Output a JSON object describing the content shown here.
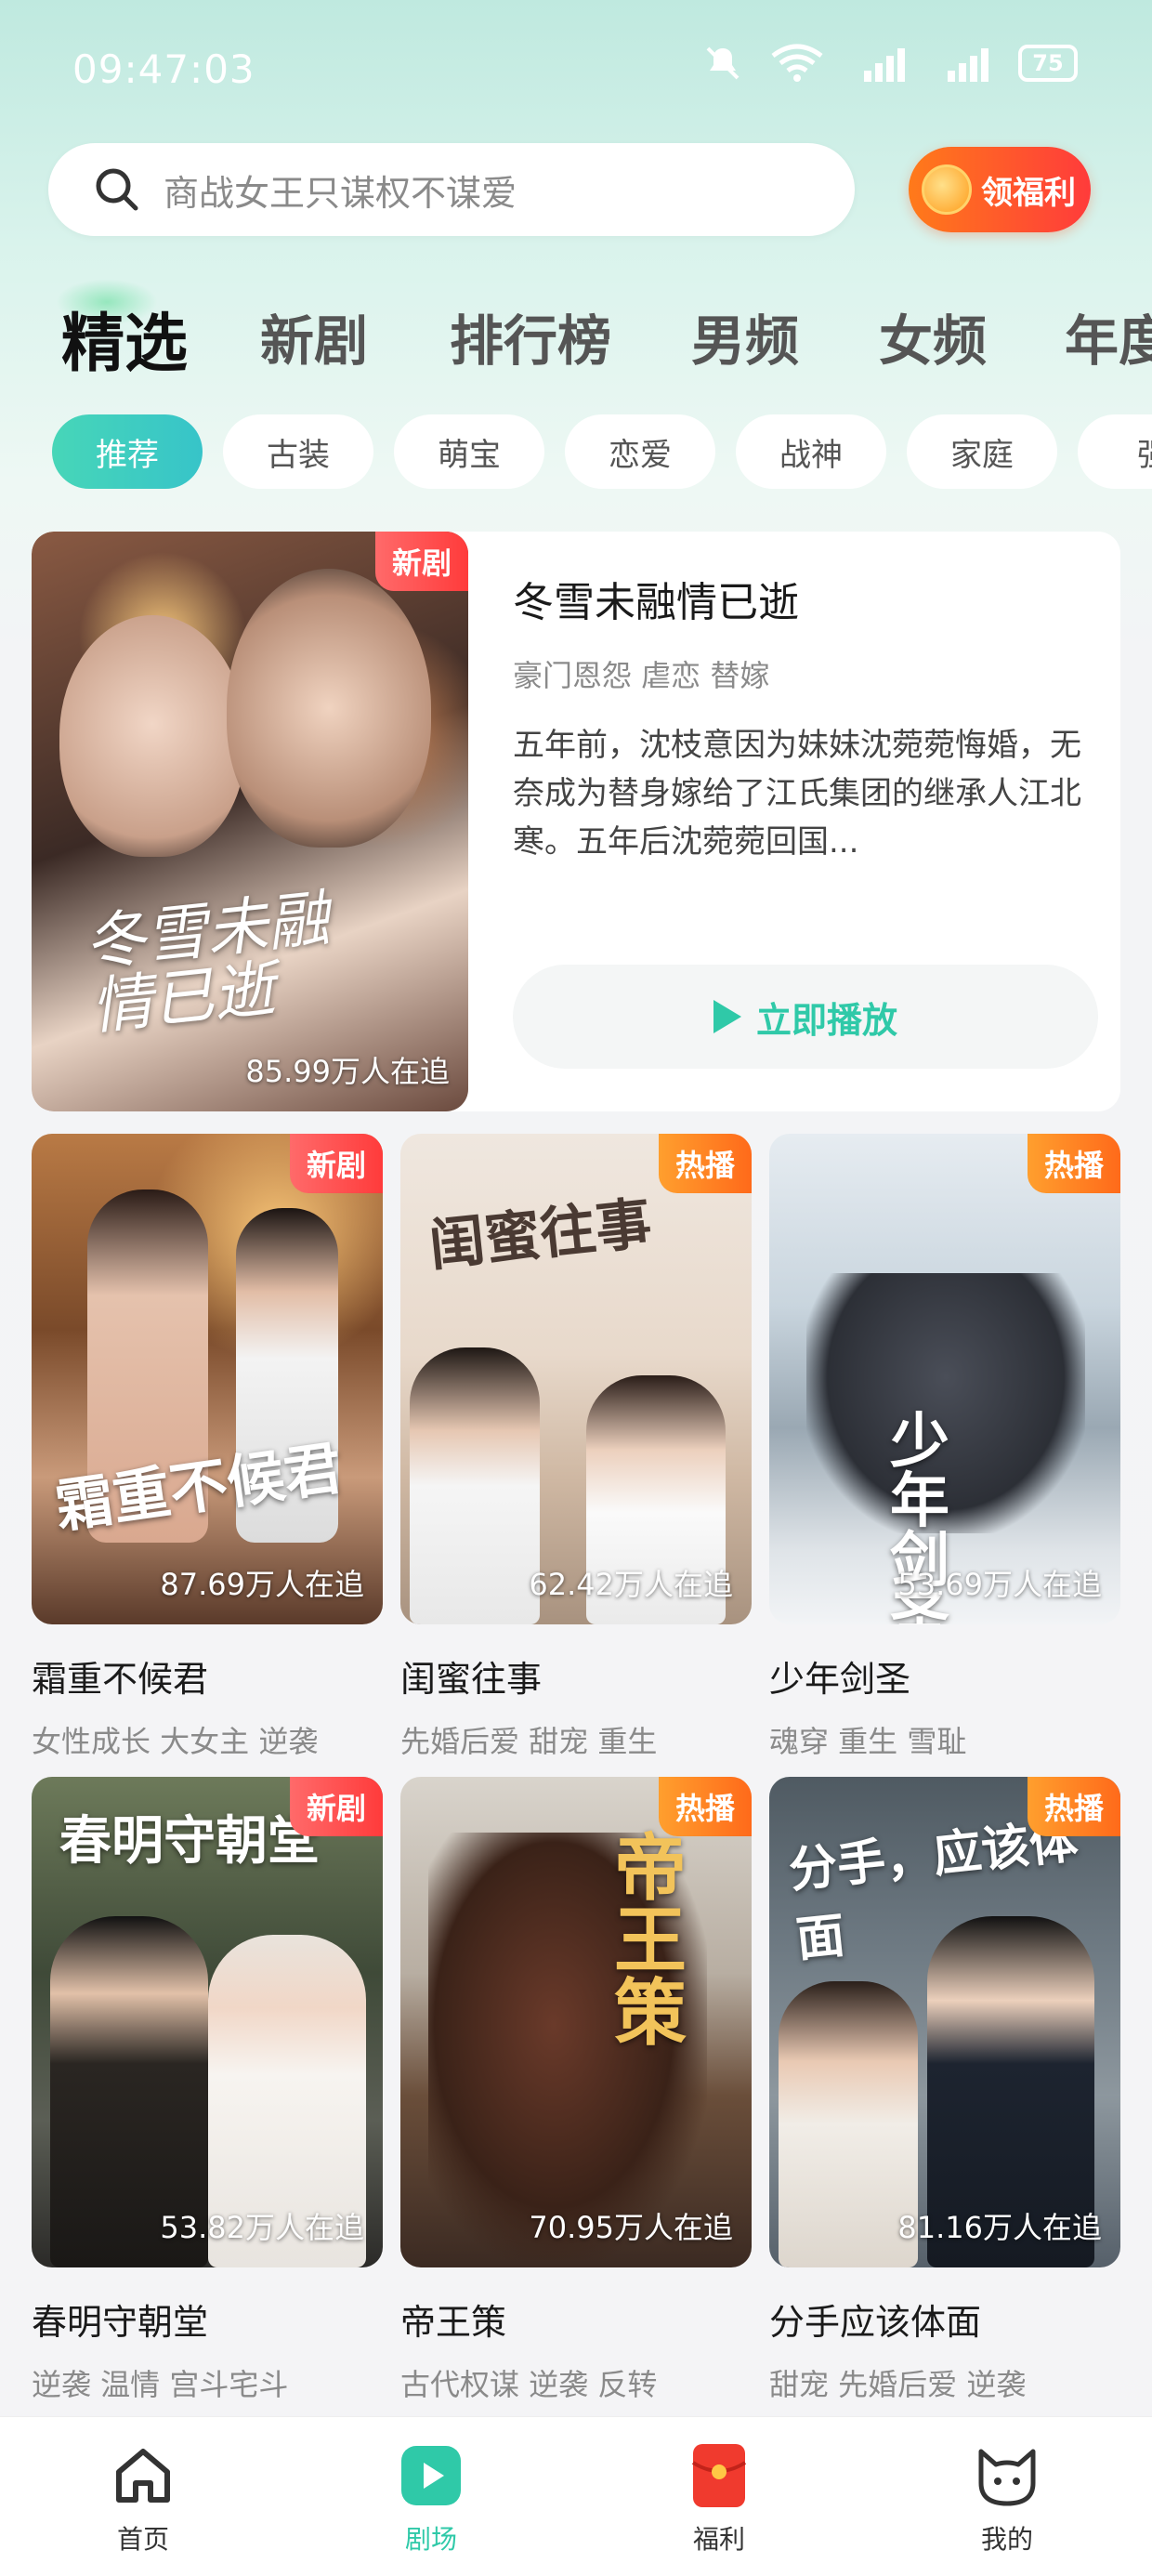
{
  "status_bar": {
    "time": "09:47:03",
    "battery": "75"
  },
  "search": {
    "placeholder": "商战女王只谋权不谋爱"
  },
  "welfare_button": {
    "label": "领福利"
  },
  "tabs": [
    "精选",
    "新剧",
    "排行榜",
    "男频",
    "女频",
    "年度"
  ],
  "chips": [
    "推荐",
    "古装",
    "萌宝",
    "恋爱",
    "战神",
    "家庭",
    "强"
  ],
  "featured": {
    "badge": "新剧",
    "cover_text": "冬雪未融\n情已逝",
    "viewers": "85.99万人在追",
    "title": "冬雪未融情已逝",
    "tags": "豪门恩怨 虐恋 替嫁",
    "description": "五年前，沈枝意因为妹妹沈菀菀悔婚，无奈成为替身嫁给了江氏集团的继承人江北寒。五年后沈菀菀回国...",
    "play_label": "立即播放"
  },
  "dramas": [
    {
      "title": "霜重不候君",
      "tags": "女性成长 大女主 逆袭",
      "viewers": "87.69万人在追",
      "badge": "新剧",
      "cover_text": "霜重不候君"
    },
    {
      "title": "闺蜜往事",
      "tags": "先婚后爱 甜宠 重生",
      "viewers": "62.42万人在追",
      "badge": "热播",
      "cover_text": "闺蜜往事"
    },
    {
      "title": "少年剑圣",
      "tags": "魂穿 重生 雪耻",
      "viewers": "53.69万人在追",
      "badge": "热播",
      "cover_text": "少年剑圣"
    },
    {
      "title": "春明守朝堂",
      "tags": "逆袭 温情 宫斗宅斗",
      "viewers": "53.82万人在追",
      "badge": "新剧",
      "cover_text": "春明守朝堂"
    },
    {
      "title": "帝王策",
      "tags": "古代权谋 逆袭 反转",
      "viewers": "70.95万人在追",
      "badge": "热播",
      "cover_text": "帝王策"
    },
    {
      "title": "分手应该体面",
      "tags": "甜宠 先婚后爱 逆袭",
      "viewers": "81.16万人在追",
      "badge": "热播",
      "cover_text": "分手，应该体面"
    }
  ],
  "bottom_nav": [
    {
      "label": "首页",
      "icon": "home-icon"
    },
    {
      "label": "剧场",
      "icon": "theater-play-icon"
    },
    {
      "label": "福利",
      "icon": "red-envelope-icon"
    },
    {
      "label": "我的",
      "icon": "cat-profile-icon"
    }
  ],
  "colors": {
    "accent": "#2fc9a8",
    "new_badge": "#ff3b3b",
    "hot_badge": "#ff7a1a"
  }
}
